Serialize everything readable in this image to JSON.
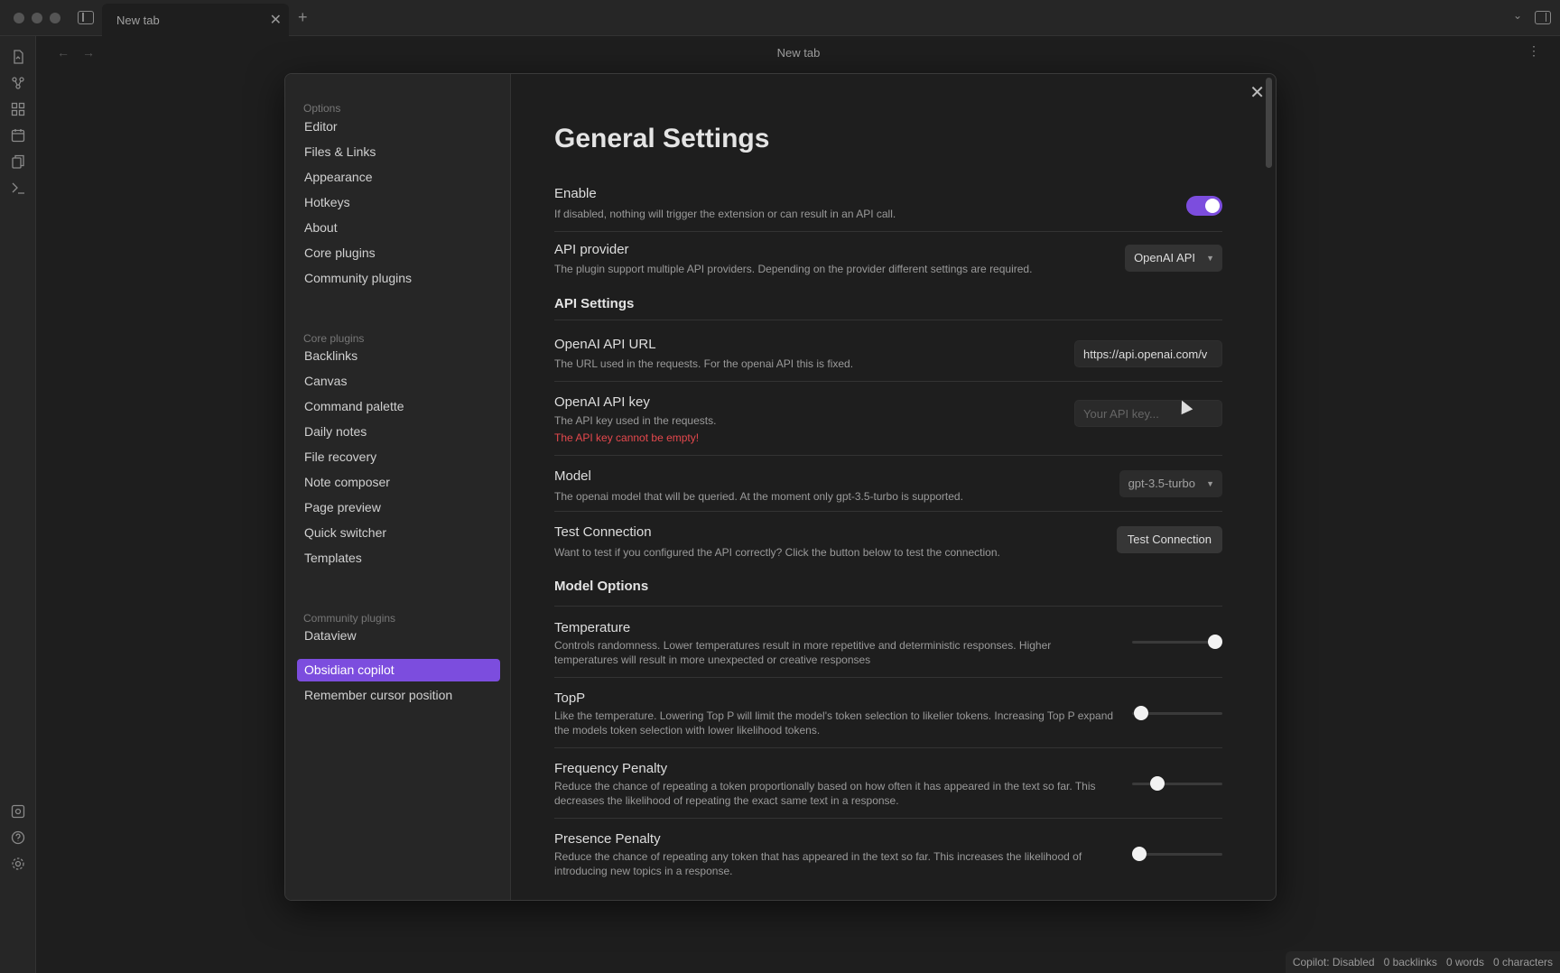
{
  "titlebar": {
    "tab_title": "New tab",
    "close_glyph": "✕",
    "new_tab_glyph": "+",
    "tab_list_glyph": "⌄"
  },
  "ribbon": {
    "icons": [
      "open-quick-switcher-icon",
      "graph-view-icon",
      "canvas-icon",
      "daily-notes-icon",
      "templates-icon",
      "command-palette-icon",
      "vault-icon",
      "help-icon",
      "settings-icon"
    ]
  },
  "navhdr": {
    "title": "New tab",
    "back_glyph": "←",
    "forward_glyph": "→",
    "more_glyph": "⋮"
  },
  "statusbar": {
    "copilot": "Copilot: Disabled",
    "backlinks": "0 backlinks",
    "words": "0 words",
    "characters": "0 characters"
  },
  "settings_sidebar": {
    "group_options": "Options",
    "options": [
      "Editor",
      "Files & Links",
      "Appearance",
      "Hotkeys",
      "About",
      "Core plugins",
      "Community plugins"
    ],
    "group_core": "Core plugins",
    "core": [
      "Backlinks",
      "Canvas",
      "Command palette",
      "Daily notes",
      "File recovery",
      "Note composer",
      "Page preview",
      "Quick switcher",
      "Templates"
    ],
    "group_community": "Community plugins",
    "community": [
      "Dataview",
      "Obsidian copilot",
      "Remember cursor position"
    ],
    "active": "Obsidian copilot"
  },
  "modal": {
    "close_glyph": "✕",
    "title": "General Settings"
  },
  "settings": {
    "enable": {
      "name": "Enable",
      "desc": "If disabled, nothing will trigger the extension or can result in an API call.",
      "on": true
    },
    "api_provider": {
      "name": "API provider",
      "desc": "The plugin support multiple API providers. Depending on the provider different settings are required.",
      "value": "OpenAI API"
    },
    "api_settings_heading": "API Settings",
    "api_url": {
      "name": "OpenAI API URL",
      "desc": "The URL used in the requests. For the openai API this is fixed.",
      "value": "https://api.openai.com/v"
    },
    "api_key": {
      "name": "OpenAI API key",
      "desc": "The API key used in the requests.",
      "error": "The API key cannot be empty!",
      "placeholder": "Your API key..."
    },
    "model": {
      "name": "Model",
      "desc": "The openai model that will be queried. At the moment only gpt-3.5-turbo is supported.",
      "value": "gpt-3.5-turbo"
    },
    "test_connection": {
      "name": "Test Connection",
      "desc": "Want to test if you configured the API correctly? Click the button below to test the connection.",
      "button": "Test Connection"
    },
    "model_options_heading": "Model Options",
    "temperature": {
      "name": "Temperature",
      "desc": "Controls randomness. Lower temperatures result in more repetitive and deterministic responses. Higher temperatures will result in more unexpected or creative responses",
      "level": 0.92
    },
    "top_p": {
      "name": "TopP",
      "desc": "Like the temperature. Lowering Top P will limit the model's token selection to likelier tokens. Increasing Top P expand the models token selection with lower likelihood tokens.",
      "level": 0.1
    },
    "frequency_penalty": {
      "name": "Frequency Penalty",
      "desc": "Reduce the chance of repeating a token proportionally based on how often it has appeared in the text so far. This decreases the likelihood of repeating the exact same text in a response.",
      "level": 0.28
    },
    "presence_penalty": {
      "name": "Presence Penalty",
      "desc": "Reduce the chance of repeating any token that has appeared in the text so far. This increases the likelihood of introducing new topics in a response.",
      "level": 0.08
    }
  },
  "colors": {
    "accent": "#7c4dde",
    "error": "#e5484d",
    "background": "#1e1e1e",
    "sidebar": "#262626"
  }
}
